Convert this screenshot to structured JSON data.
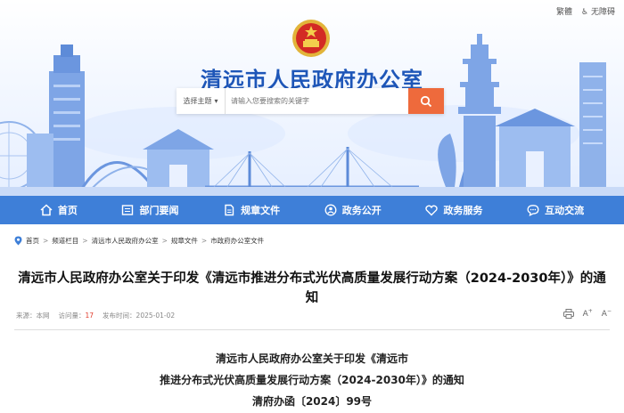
{
  "header": {
    "top_links": [
      "繁體",
      "无障碍"
    ],
    "site_title": "清远市人民政府办公室",
    "search": {
      "select_label": "选择主题",
      "placeholder": "请输入您要搜索的关键字"
    }
  },
  "nav": {
    "items": [
      {
        "label": "首页",
        "icon": "home-icon"
      },
      {
        "label": "部门要闻",
        "icon": "news-icon"
      },
      {
        "label": "规章文件",
        "icon": "document-icon"
      },
      {
        "label": "政务公开",
        "icon": "person-icon"
      },
      {
        "label": "政务服务",
        "icon": "service-icon"
      },
      {
        "label": "互动交流",
        "icon": "chat-icon"
      }
    ]
  },
  "breadcrumb": [
    "首页",
    "频道栏目",
    "清远市人民政府办公室",
    "规章文件",
    "市政府办公室文件"
  ],
  "article": {
    "title": "清远市人民政府办公室关于印发《清远市推进分布式光伏高质量发展行动方案（2024-2030年）》的通知",
    "source_label": "来源：本网",
    "views_label": "访问量：",
    "views_count": "17",
    "date_label": "发布时间：2025-01-02",
    "doc_lines": [
      "清远市人民政府办公室关于印发《清远市",
      "推进分布式光伏高质量发展行动方案（2024-2030年）》的通知",
      "清府办函〔2024〕99号"
    ]
  },
  "colors": {
    "nav_bg": "#3e7fd8",
    "title_blue": "#1e56b8",
    "search_button": "#ee6a3c",
    "views_red": "#e03c2c"
  }
}
